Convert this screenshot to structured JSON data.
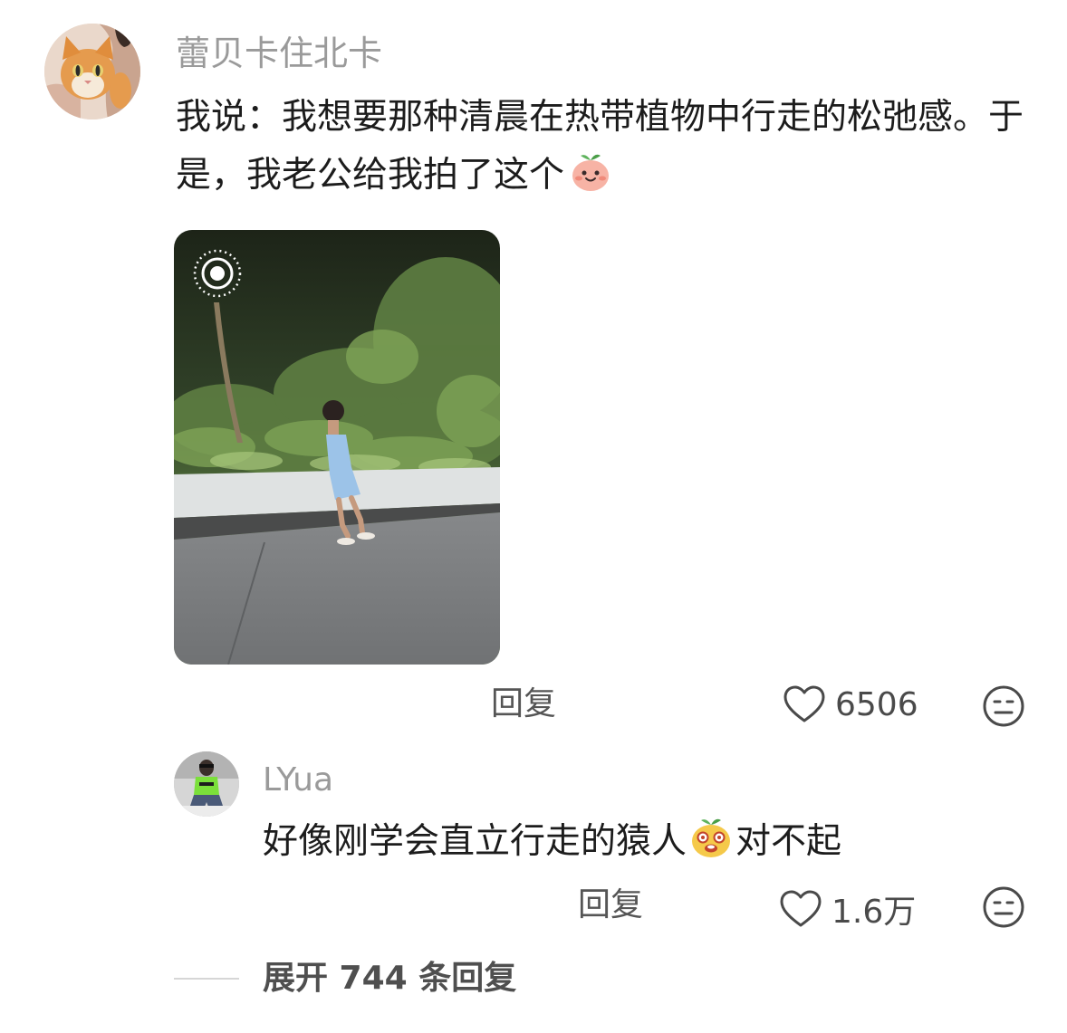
{
  "comment": {
    "username": "蕾贝卡住北卡",
    "text": "我说：我想要那种清晨在热带植物中行走的松弛感。于是，我老公给我拍了这个",
    "emoji": "peach-smile-emoji",
    "reply_label": "回复",
    "like_count": "6506"
  },
  "reply": {
    "username": "LYua",
    "text_before": "好像刚学会直立行走的猿人",
    "emoji": "yellow-laughing-emoji",
    "text_after": "对不起",
    "reply_label": "回复",
    "like_count": "1.6万"
  },
  "expand": {
    "label": "展开 744 条回复"
  },
  "colors": {
    "username": "#9a9a9a",
    "text": "#1c1c1c",
    "icon": "#4a4a4a"
  }
}
